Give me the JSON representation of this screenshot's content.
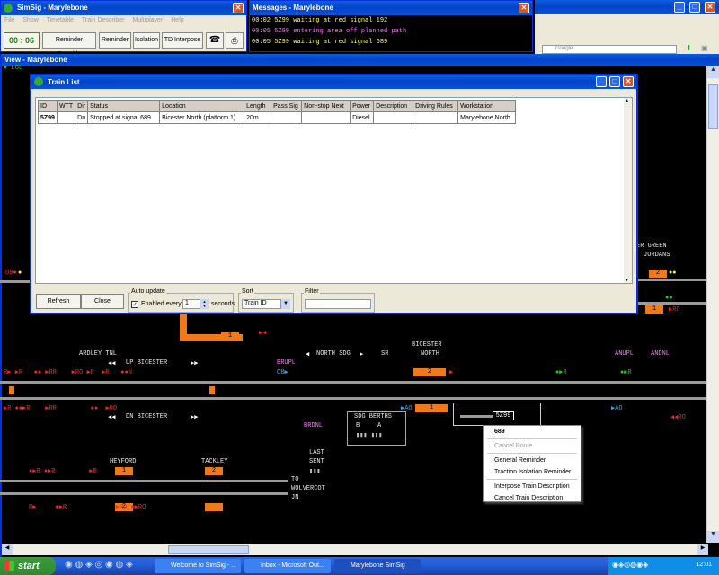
{
  "main_window": {
    "title": "SimSig - Marylebone",
    "menu": [
      "File",
      "Show",
      "Timetable",
      "Train Describer",
      "Multiplayer",
      "Help"
    ],
    "clock": "00 : 06",
    "toolbar": [
      "Reminder Override",
      "Reminder",
      "Isolation",
      "TD Interpose"
    ]
  },
  "messages": {
    "title": "Messages - Marylebone",
    "lines": [
      {
        "text": "00:02 5Z99 waiting at red signal 192",
        "color": "#ffff66"
      },
      {
        "text": "00:05 5Z99 entering area off planned path",
        "color": "#ff66ff"
      },
      {
        "text": "00:05 5Z99 waiting at red signal 689",
        "color": "#ffff66"
      }
    ]
  },
  "browser_strip": {
    "search_text": "Google"
  },
  "view_window": {
    "title": "View - Marylebone"
  },
  "train_list": {
    "title": "Train List",
    "columns": [
      "ID",
      "WTT",
      "Dir",
      "Status",
      "Location",
      "Length",
      "Pass Sig",
      "Non-stop Next",
      "Power",
      "Description",
      "Driving Rules",
      "Workstation"
    ],
    "rows": [
      [
        "5Z99",
        "",
        "Dn",
        "Stopped at signal 689",
        "Bicester North (platform 1)",
        "20m",
        "",
        "",
        "Diesel",
        "",
        "",
        "Marylebone North"
      ]
    ],
    "refresh_label": "Refresh",
    "close_label": "Close",
    "auto_update_label": "Auto update",
    "enabled_label": "Enabled every",
    "interval": "1",
    "seconds_label": "seconds",
    "sort_label": "Sort",
    "sort_value": "Train ID",
    "filter_label": "Filter",
    "filter_value": ""
  },
  "map_labels": {
    "ardley": "ARDLEY TNL",
    "up_bicester": "UP BICESTER",
    "dn_bicester": "DN BICESTER",
    "north_sdg": "NORTH SDG",
    "sr": "SR",
    "bicester_north_1": "BICESTER",
    "bicester_north_2": "NORTH",
    "bupl": "BRUPL",
    "brdnl": "BRDNL",
    "anupl": "ANUPL",
    "andnl": "ANDNL",
    "sdg_berths": "SDG BERTHS",
    "berth_b": "B",
    "berth_a": "A",
    "heyford": "HEYFORD",
    "tackley": "TACKLEY",
    "last_sent_1": "LAST",
    "last_sent_2": "SENT",
    "to_wolvercot_1": "TO",
    "to_wolvercot_2": "WOLVERCOT",
    "to_wolvercot_3": "JN",
    "green_1": "ER GREEN",
    "green_2": "JORDANS",
    "berth_2a": "2",
    "berth_1a": "1",
    "berth_2b": "2",
    "berth_1b": "1",
    "berth_1c": "1",
    "berth_2c": "2",
    "berth_2d": "2",
    "berth_1d": "1",
    "train_id": "5Z99"
  },
  "context_menu": {
    "header": "689",
    "items": [
      {
        "label": "Cancel Route",
        "enabled": false
      },
      {
        "label": "General Reminder",
        "enabled": true
      },
      {
        "label": "Traction Isolation Reminder",
        "enabled": true
      },
      {
        "label": "Interpose Train Description",
        "enabled": true
      },
      {
        "label": "Cancel Train Description",
        "enabled": true
      }
    ]
  },
  "taskbar": {
    "start": "start",
    "tasks": [
      "Welcome to SimSig - ...",
      "Inbox - Microsoft Out...",
      "Marylebone SimSig"
    ],
    "clock": "12:01"
  },
  "colors": {
    "xp_blue": "#0a52d8",
    "berth_orange": "#f07a1a",
    "signal_red": "#ff2020",
    "signal_yellow": "#ffff00",
    "signal_green": "#22cc22"
  }
}
